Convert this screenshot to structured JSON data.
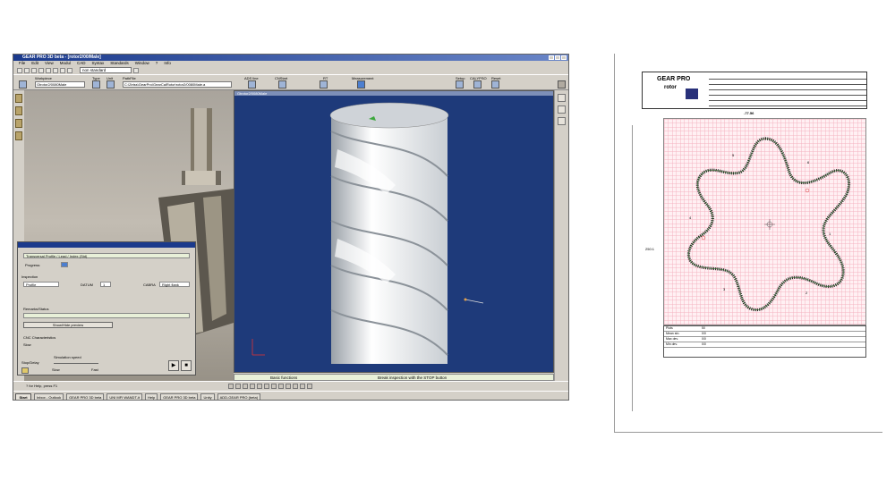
{
  "app": {
    "window_title": "GEAR PRO 3D beta - [rotor2/00/Male]",
    "menu": [
      "File",
      "Edit",
      "View",
      "Modul",
      "CAD",
      "Syntax",
      "Standards",
      "Window",
      "?",
      "Info"
    ],
    "combo_value": "non standard"
  },
  "toolbar2": {
    "workpiece_label": "Workpiece",
    "workpiece_value": "Gtrotor2/0080Male",
    "type_label": "Type",
    "unit_label": "Unit",
    "path_label": "PathFile",
    "path_value": "C:\\Zeiss\\GearPro\\GearCalRotor\\rotor2/0080Male.a",
    "adsline_label": "ADS line",
    "cnc_label": "CNStart",
    "rt_label": "RT",
    "measurement_label": "Measurement",
    "setup_label": "Setup",
    "calypso_label": "CALYPSO",
    "reset_label": "Reset"
  },
  "view3d": {
    "title": "Gtrotor2/0080Male"
  },
  "dialog": {
    "title": "",
    "mode_value": "Transversal Profile / Lead / Index (Std)",
    "progress_label": "Progress:",
    "inspection_label": "Inspection",
    "inspection_value": "Profile",
    "datum_label": "DATUM",
    "datum_value": "1",
    "cabra_label": "CABRA",
    "cabra_value": "Right flank",
    "remarks_label": "Remarks/Status",
    "preview_button": "Show/Hide preview",
    "cnc_label": "CNC Characteristics",
    "slow_label": "Slow",
    "speed_label": "Simulation speed",
    "stop_delay_label": "Stop/Delay",
    "slow_speed": "Slow",
    "fast_speed": "Fast"
  },
  "status": {
    "left": "Basic functions",
    "right": "Break inspection with the STOP button"
  },
  "bottom_left": "? for Help, press F1",
  "taskbar": {
    "start": "Start",
    "tasks": [
      "Inbox - Outlook",
      "GEAR PRO 3D beta",
      "UNI MFI WANDT-it",
      "Help",
      "GEAR PRO 3D beta",
      "Unity",
      "ADD-GEAR PRO (beta)"
    ],
    "clock": ""
  },
  "report": {
    "brand_top": "GEAR PRO",
    "brand_bottom": "rotor",
    "scale": "250:1",
    "deviation": "-77.56",
    "lobes": [
      "1",
      "2",
      "3",
      "4",
      "5",
      "6"
    ],
    "table_rows": [
      {
        "label": "Plots",
        "value": "50"
      },
      {
        "label": "Mean stn.",
        "value": "0/0"
      },
      {
        "label": "Max dev.",
        "value": "0/0"
      },
      {
        "label": "Min dev.",
        "value": "0/0"
      }
    ]
  }
}
